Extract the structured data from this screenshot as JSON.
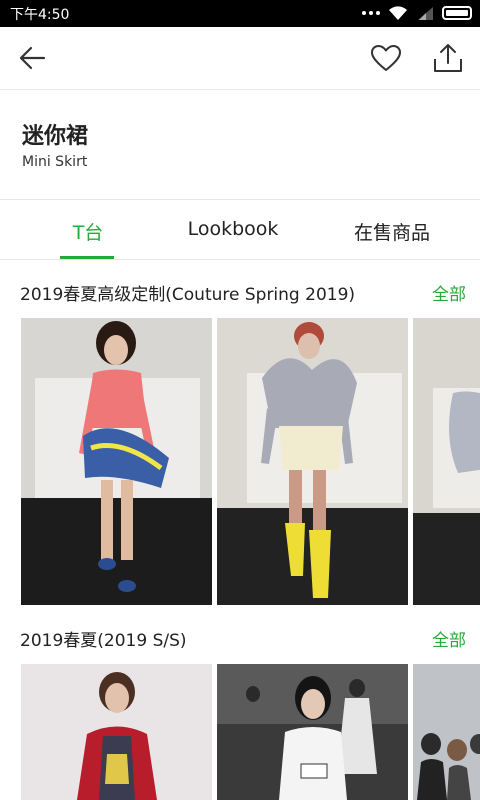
{
  "status_bar": {
    "time": "下午4:50"
  },
  "header": {
    "back_icon": "arrow-left-icon",
    "favorite_icon": "heart-outline-icon",
    "share_icon": "share-upload-icon"
  },
  "title": {
    "zh": "迷你裙",
    "en": "Mini Skirt"
  },
  "tabs": [
    {
      "label": "T台",
      "active": true
    },
    {
      "label": "Lookbook",
      "active": false
    },
    {
      "label": "在售商品",
      "active": false
    }
  ],
  "sections": [
    {
      "title": "2019春夏高级定制(Couture Spring 2019)",
      "more_label": "全部"
    },
    {
      "title": "2019春夏(2019 S/S)",
      "more_label": "全部"
    }
  ],
  "colors": {
    "accent": "#26a93b"
  }
}
